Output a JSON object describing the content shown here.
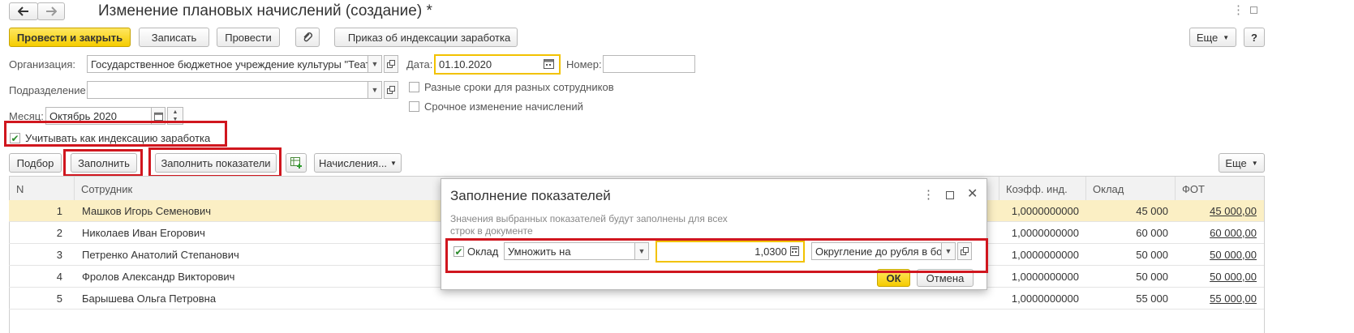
{
  "window": {
    "title": "Изменение плановых начислений (создание) *"
  },
  "toolbar": {
    "post_close": "Провести и закрыть",
    "save": "Записать",
    "post": "Провести",
    "indexation_order": "Приказ об индексации заработка",
    "more": "Еще",
    "help": "?"
  },
  "form": {
    "org_label": "Организация:",
    "org_value": "Государственное бюджетное учреждение культуры \"Театра",
    "date_label": "Дата:",
    "date_value": "01.10.2020",
    "number_label": "Номер:",
    "number_value": "",
    "dept_label": "Подразделение:",
    "dept_value": "",
    "different_dates_label": "Разные сроки для разных сотрудников",
    "urgent_change_label": "Срочное изменение начислений",
    "month_label": "Месяц:",
    "month_value": "Октябрь 2020",
    "consider_indexation_label": "Учитывать как индексацию заработка"
  },
  "table_toolbar": {
    "pick": "Подбор",
    "fill": "Заполнить",
    "fill_indicators": "Заполнить показатели",
    "accruals": "Начисления...",
    "more": "Еще"
  },
  "table": {
    "columns": {
      "n": "N",
      "employee": "Сотрудник",
      "coeff": "Коэфф. инд.",
      "salary": "Оклад",
      "fot": "ФОТ"
    },
    "rows": [
      {
        "n": "1",
        "employee": "Машков Игорь Семенович",
        "coeff": "1,0000000000",
        "salary": "45 000",
        "fot": "45 000,00"
      },
      {
        "n": "2",
        "employee": "Николаев Иван Егорович",
        "coeff": "1,0000000000",
        "salary": "60 000",
        "fot": "60 000,00"
      },
      {
        "n": "3",
        "employee": "Петренко Анатолий Степанович",
        "coeff": "1,0000000000",
        "salary": "50 000",
        "fot": "50 000,00"
      },
      {
        "n": "4",
        "employee": "Фролов Александр Викторович",
        "coeff": "1,0000000000",
        "salary": "50 000",
        "fot": "50 000,00"
      },
      {
        "n": "5",
        "employee": "Барышева Ольга Петровна",
        "coeff": "1,0000000000",
        "salary": "55 000",
        "fot": "55 000,00"
      }
    ]
  },
  "dialog": {
    "title": "Заполнение показателей",
    "hint_line1": "Значения выбранных показателей будут заполнены для всех",
    "hint_line2": "строк в документе",
    "salary_label": "Оклад",
    "operation": "Умножить на",
    "value": "1,0300",
    "rounding": "Округление до рубля в бол",
    "ok": "ОК",
    "cancel": "Отмена"
  },
  "colors": {
    "accent_yellow": "#f5cc00",
    "highlight_row": "#fbefc4",
    "annotation_red": "#d0161e",
    "field_focus": "#f2c200"
  },
  "icons": [
    "back-arrow-icon",
    "forward-arrow-icon",
    "paperclip-icon",
    "printer-icon",
    "link-icon",
    "calendar-icon",
    "spin-icon",
    "table-add-icon",
    "dots-menu-icon",
    "maximize-icon",
    "close-icon",
    "checkmark-icon"
  ]
}
